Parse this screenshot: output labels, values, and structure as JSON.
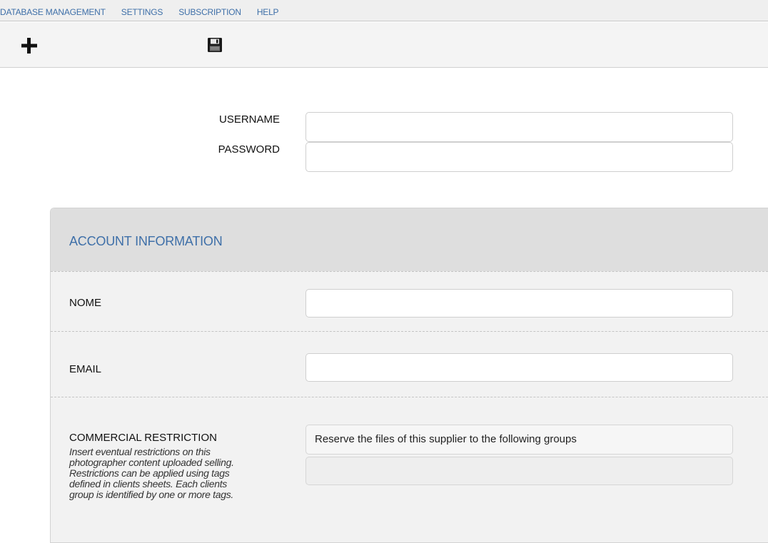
{
  "menu": {
    "items": [
      {
        "label": "DATABASE MANAGEMENT"
      },
      {
        "label": "SETTINGS"
      },
      {
        "label": "SUBSCRIPTION"
      },
      {
        "label": "HELP"
      }
    ]
  },
  "toolbar": {
    "add_icon": "plus-icon",
    "save_icon": "floppy-disk-icon"
  },
  "login": {
    "username_label": "USERNAME",
    "username_value": "",
    "password_label": "PASSWORD",
    "password_value": ""
  },
  "account": {
    "title": "ACCOUNT INFORMATION",
    "nome_label": "NOME",
    "nome_value": "",
    "email_label": "EMAIL",
    "email_value": "",
    "commercial_label": "COMMERCIAL RESTRICTION",
    "commercial_desc": "Insert eventual restrictions on this photographer content uploaded selling. Restrictions can be applied using tags defined in clients sheets. Each clients group is identified by one or more tags.",
    "reserve_text": "Reserve the files of this supplier to the following groups",
    "groups_value": ""
  },
  "colors": {
    "accent": "#3e6fa8",
    "panel_bg": "#f2f2f2",
    "panel_header_bg": "#dedede"
  }
}
